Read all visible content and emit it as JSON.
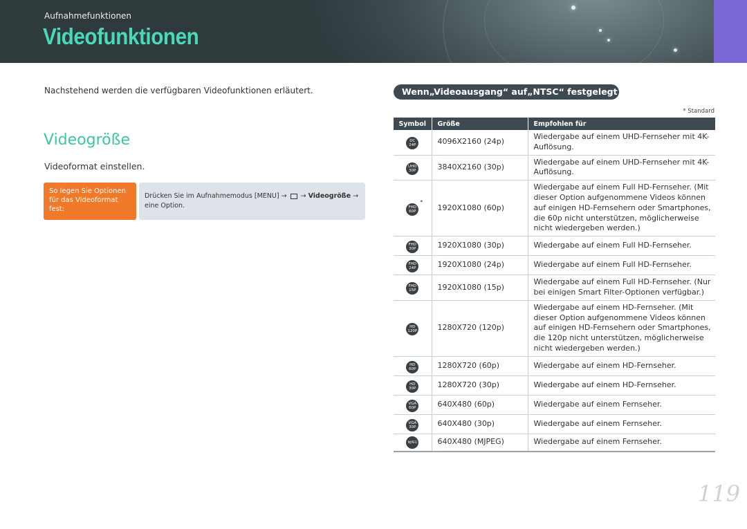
{
  "header": {
    "section": "Aufnahmefunktionen",
    "title": "Videofunktionen"
  },
  "left": {
    "intro": "Nachstehend werden die verfügbaren Videofunktionen erläutert.",
    "subheading": "Videogröße",
    "description": "Videoformat einstellen.",
    "howto": {
      "label": "So legen Sie Optionen für das Videoformat fest:",
      "text_prefix": "Drücken Sie im Aufnahmemodus [MENU] → ",
      "icon": "video-menu-icon",
      "text_bold": "Videogröße",
      "text_suffix": "eine Option.",
      "arrow": "→"
    }
  },
  "right": {
    "pill": "Wenn„Videoausgang“ auf„NTSC“ festgelegt ist",
    "standard_note": "* Standard",
    "columns": [
      "Symbol",
      "Größe",
      "Empfohlen für"
    ],
    "rows": [
      {
        "icon_top": "DC",
        "icon_bot": "24P",
        "size": "4096X2160 (24p)",
        "rec": "Wiedergabe auf einem UHD-Fernseher mit 4K-Auflösung.",
        "default": false
      },
      {
        "icon_top": "UHD",
        "icon_bot": "30P",
        "size": "3840X2160 (30p)",
        "rec": "Wiedergabe auf einem UHD-Fernseher mit 4K-Auflösung.",
        "default": false
      },
      {
        "icon_top": "FHD",
        "icon_bot": "60P",
        "size": "1920X1080 (60p)",
        "rec": "Wiedergabe auf einem Full HD-Fernseher. (Mit dieser Option aufgenommene Videos können auf einigen HD-Fernsehern oder Smartphones, die 60p nicht unterstützen, möglicherweise nicht wiedergeben werden.)",
        "default": true
      },
      {
        "icon_top": "FHD",
        "icon_bot": "30P",
        "size": "1920X1080 (30p)",
        "rec": "Wiedergabe auf einem Full HD-Fernseher.",
        "default": false
      },
      {
        "icon_top": "FHD",
        "icon_bot": "24P",
        "size": "1920X1080 (24p)",
        "rec": "Wiedergabe auf einem Full HD-Fernseher.",
        "default": false
      },
      {
        "icon_top": "FHD",
        "icon_bot": "15P",
        "size": "1920X1080 (15p)",
        "rec": "Wiedergabe auf einem Full HD-Fernseher. (Nur bei einigen Smart Filter-Optionen verfügbar.)",
        "default": false
      },
      {
        "icon_top": "HD",
        "icon_bot": "120P",
        "size": "1280X720 (120p)",
        "rec": "Wiedergabe auf einem HD-Fernseher. (Mit dieser Option aufgenommene Videos können auf einigen HD-Fernsehern oder Smartphones, die 120p nicht unterstützen, möglicherweise nicht wiedergeben werden.)",
        "default": false
      },
      {
        "icon_top": "HD",
        "icon_bot": "60P",
        "size": "1280X720 (60p)",
        "rec": "Wiedergabe auf einem HD-Fernseher.",
        "default": false
      },
      {
        "icon_top": "HD",
        "icon_bot": "30P",
        "size": "1280X720 (30p)",
        "rec": "Wiedergabe auf einem HD-Fernseher.",
        "default": false
      },
      {
        "icon_top": "VGA",
        "icon_bot": "60P",
        "size": "640X480 (60p)",
        "rec": "Wiedergabe auf einem Fernseher.",
        "default": false
      },
      {
        "icon_top": "VGA",
        "icon_bot": "30P",
        "size": "640X480 (30p)",
        "rec": "Wiedergabe auf einem Fernseher.",
        "default": false
      },
      {
        "icon_top": "MJPEG",
        "icon_bot": "",
        "size": "640X480 (MJPEG)",
        "rec": "Wiedergabe auf einem Fernseher.",
        "default": false
      }
    ]
  },
  "page_number": "119",
  "colors": {
    "accent_green": "#4ad9b8",
    "orange": "#f07a2a",
    "purple_tab": "#7b68d4",
    "table_header": "#3d4a52"
  }
}
